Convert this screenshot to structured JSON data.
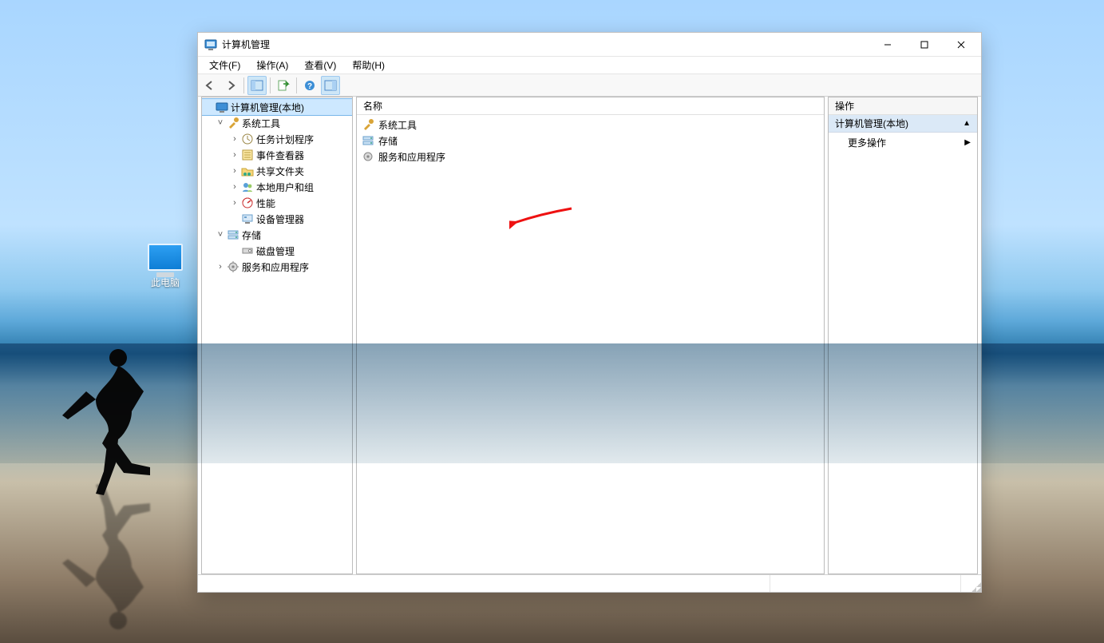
{
  "desktop": {
    "this_pc": "此电脑"
  },
  "window": {
    "title": "计算机管理",
    "menus": {
      "file": "文件(F)",
      "action": "操作(A)",
      "view": "查看(V)",
      "help": "帮助(H)"
    },
    "list_header": "名称",
    "actions": {
      "header": "操作",
      "context": "计算机管理(本地)",
      "more": "更多操作"
    },
    "tree": {
      "root": "计算机管理(本地)",
      "system_tools": "系统工具",
      "task_scheduler": "任务计划程序",
      "event_viewer": "事件查看器",
      "shared_folders": "共享文件夹",
      "local_users_groups": "本地用户和组",
      "performance": "性能",
      "device_manager": "设备管理器",
      "storage": "存储",
      "disk_management": "磁盘管理",
      "services_apps": "服务和应用程序"
    },
    "list": {
      "system_tools": "系统工具",
      "storage": "存储",
      "services_apps": "服务和应用程序"
    }
  }
}
